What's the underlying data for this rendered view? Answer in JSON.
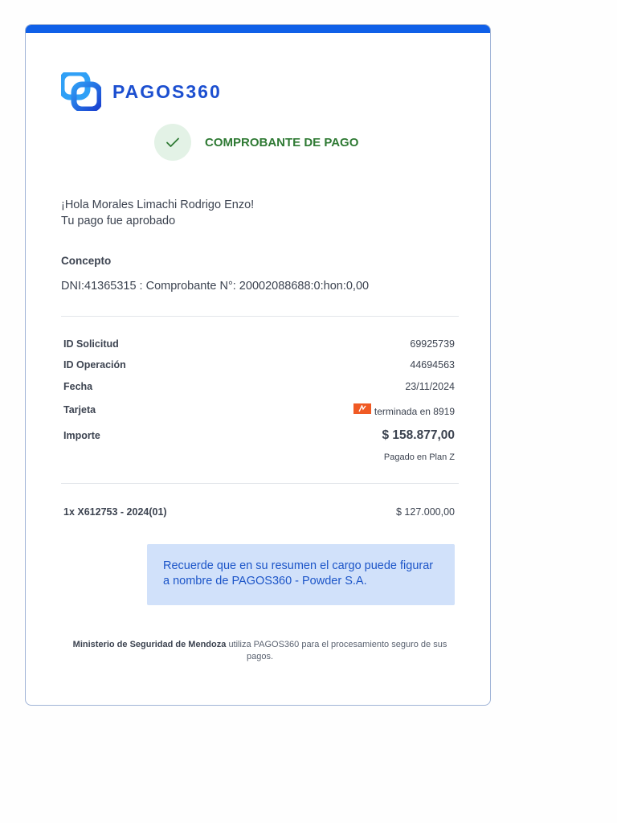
{
  "brand": {
    "name": "PAGOS360",
    "accent_color": "#1060e8",
    "logo_icon": "pagos360-logo-icon"
  },
  "status": {
    "icon": "check-icon",
    "title": "COMPROBANTE DE PAGO",
    "color": "#2f7a34"
  },
  "greeting": {
    "line1": "¡Hola Morales Limachi Rodrigo Enzo!",
    "line2": "Tu pago fue aprobado"
  },
  "concept": {
    "label": "Concepto",
    "value": "DNI:41365315 : Comprobante N°: 20002088688:0:hon:0,00"
  },
  "details": {
    "solicitud_label": "ID Solicitud",
    "solicitud_value": "69925739",
    "operacion_label": "ID Operación",
    "operacion_value": "44694563",
    "fecha_label": "Fecha",
    "fecha_value": "23/11/2024",
    "tarjeta_label": "Tarjeta",
    "tarjeta_value": "terminada en 8919",
    "tarjeta_icon": "card-brand-icon",
    "importe_label": "Importe",
    "importe_value": "$ 158.877,00",
    "plan": "Pagado en Plan Z"
  },
  "item": {
    "label": "1x X612753 - 2024(01)",
    "value": "$ 127.000,00"
  },
  "notice": {
    "text": "Recuerde que en su resumen el cargo puede figurar a nombre de PAGOS360 - Powder S.A."
  },
  "footer": {
    "org": "Ministerio de Seguridad de Mendoza",
    "text": "utiliza PAGOS360 para el procesamiento seguro de sus pagos."
  }
}
